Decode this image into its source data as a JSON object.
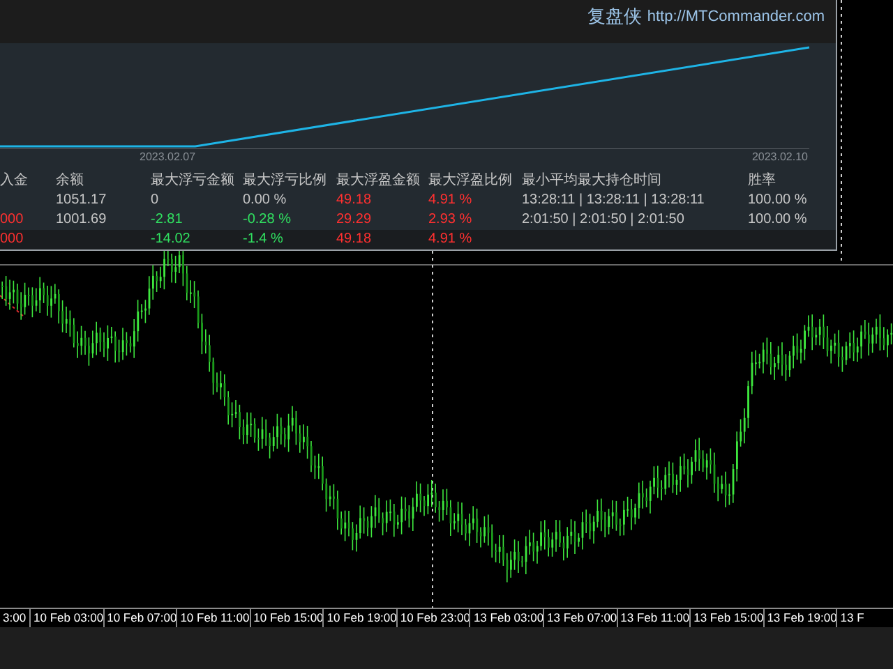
{
  "header": {
    "brand": "复盘侠",
    "url": "http://MTCommander.com"
  },
  "equity_chart": {
    "dates": [
      "2023.02.07",
      "2023.02.10"
    ]
  },
  "table": {
    "columns": [
      "入金",
      "余额",
      "最大浮亏金额",
      "最大浮亏比例",
      "最大浮盈金额",
      "最大浮盈比例",
      "最小平均最大持仓时间",
      "胜率"
    ],
    "rows": [
      {
        "kind": "detail",
        "cells": [
          null,
          {
            "text": "1051.17",
            "color": "#c8c8c8"
          },
          {
            "text": "0",
            "color": "#c8c8c8"
          },
          {
            "text": "0.00 %",
            "color": "#c8c8c8"
          },
          {
            "text": "49.18",
            "color": "#ff3030"
          },
          {
            "text": "4.91 %",
            "color": "#ff3030"
          },
          {
            "text": "13:28:11 | 13:28:11 | 13:28:11",
            "color": "#c8c8c8"
          },
          {
            "text": "100.00 %",
            "color": "#c8c8c8"
          }
        ]
      },
      {
        "kind": "detail",
        "cells": [
          {
            "text": "000",
            "color": "#ff3030"
          },
          {
            "text": "1001.69",
            "color": "#c8c8c8"
          },
          {
            "text": "-2.81",
            "color": "#30e060"
          },
          {
            "text": "-0.28 %",
            "color": "#30e060"
          },
          {
            "text": "29.29",
            "color": "#ff3030"
          },
          {
            "text": "2.93 %",
            "color": "#ff3030"
          },
          {
            "text": "2:01:50 | 2:01:50 | 2:01:50",
            "color": "#c8c8c8"
          },
          {
            "text": "100.00 %",
            "color": "#c8c8c8"
          }
        ]
      },
      {
        "kind": "total",
        "cells": [
          {
            "text": "000",
            "color": "#ff3030"
          },
          null,
          {
            "text": "-14.02",
            "color": "#30e060"
          },
          {
            "text": "-1.4 %",
            "color": "#30e060"
          },
          {
            "text": "49.18",
            "color": "#ff3030"
          },
          {
            "text": "4.91 %",
            "color": "#ff3030"
          },
          null,
          null
        ]
      }
    ]
  },
  "time_axis": {
    "labels": [
      "3:00",
      "10 Feb 03:00",
      "10 Feb 07:00",
      "10 Feb 11:00",
      "10 Feb 15:00",
      "10 Feb 19:00",
      "10 Feb 23:00",
      "13 Feb 03:00",
      "13 Feb 07:00",
      "13 Feb 11:00",
      "13 Feb 15:00",
      "13 Feb 19:00",
      "13 F"
    ]
  }
}
